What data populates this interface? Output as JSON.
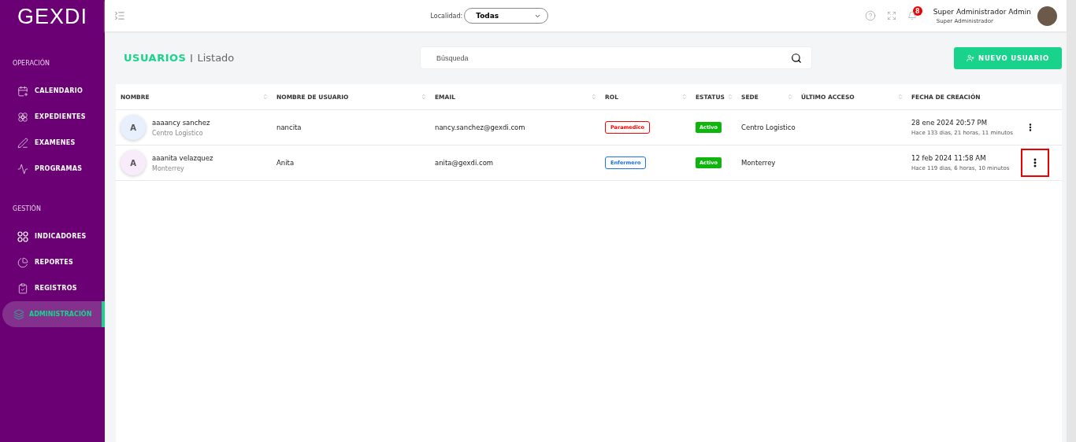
{
  "sidebar": {
    "logo": "GEXDI",
    "sections": [
      {
        "title": "OPERACIÓN",
        "items": [
          {
            "label": "CALENDARIO",
            "selected": false
          },
          {
            "label": "EXPEDIENTES",
            "selected": false
          },
          {
            "label": "EXAMENES",
            "selected": false
          },
          {
            "label": "PROGRAMAS",
            "selected": false
          }
        ]
      },
      {
        "title": "GESTIÓN",
        "items": [
          {
            "label": "INDICADORES",
            "selected": false
          },
          {
            "label": "REPORTES",
            "selected": false
          },
          {
            "label": "REGISTROS",
            "selected": false
          },
          {
            "label": "ADMINISTRACIÓN",
            "selected": true
          }
        ]
      }
    ]
  },
  "header": {
    "locality_label": "Localidad:",
    "locality_value": "Todas",
    "notifications": "8",
    "user_name": "Super Administrador Admin",
    "user_role": "Super Administrador"
  },
  "page": {
    "title": "USUARIOS",
    "subtitle": "Listado",
    "search": {
      "placeholder": "Búsqueda"
    },
    "new_button": "NUEVO USUARIO"
  },
  "table": {
    "columns": [
      {
        "label": "NOMBRE",
        "sortable": true
      },
      {
        "label": "NOMBRE DE USUARIO",
        "sortable": true
      },
      {
        "label": "EMAIL",
        "sortable": true
      },
      {
        "label": "ROL",
        "sortable": true
      },
      {
        "label": "ESTATUS",
        "sortable": true
      },
      {
        "label": "SEDE",
        "sortable": true
      },
      {
        "label": "ÚLTIMO ACCESO",
        "sortable": true
      },
      {
        "label": "FECHA DE CREACIÓN",
        "sortable": false
      }
    ],
    "rows": [
      {
        "avatar": {
          "initial": "A",
          "color": "#e8f0fd"
        },
        "name": "aaaancy sanchez",
        "location": "Centro Logistico",
        "username": "nancita",
        "email": "nancy.sanchez@gexdi.com",
        "role": {
          "label": "Paramedico",
          "color": "#ff0000"
        },
        "status": "Activo",
        "site": "Centro Logistico",
        "created": "28 ene 2024 20:57 PM",
        "created_ago": "Hace 133 dias, 21 horas, 11 minutos",
        "highlighted": false
      },
      {
        "avatar": {
          "initial": "A",
          "color": "#f8ecfa"
        },
        "name": "aaanita velazquez",
        "location": "Monterrey",
        "username": "Anita",
        "email": "anita@gexdi.com",
        "role": {
          "label": "Enfermero",
          "color": "#1a73e8"
        },
        "status": "Activo",
        "site": "Monterrey",
        "created": "12 feb 2024 11:58 AM",
        "created_ago": "Hace 119 dias, 6 horas, 10 minutos",
        "highlighted": true
      }
    ]
  }
}
